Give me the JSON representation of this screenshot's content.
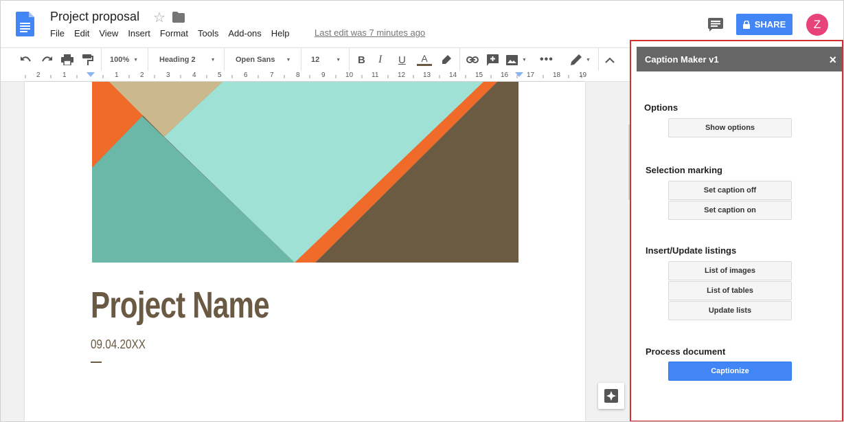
{
  "header": {
    "doc_title": "Project proposal",
    "menu": [
      "File",
      "Edit",
      "View",
      "Insert",
      "Format",
      "Tools",
      "Add-ons",
      "Help"
    ],
    "last_edit": "Last edit was 7 minutes ago",
    "share_label": "SHARE",
    "avatar_letter": "Z"
  },
  "toolbar": {
    "zoom": "100%",
    "style": "Heading 2",
    "font": "Open Sans",
    "font_size": "12"
  },
  "ruler": {
    "numbers": [
      "2",
      "1",
      "1",
      "2",
      "3",
      "4",
      "5",
      "6",
      "7",
      "8",
      "9",
      "10",
      "11",
      "12",
      "13",
      "14",
      "15",
      "16",
      "17",
      "18",
      "19"
    ]
  },
  "document": {
    "project_name": "Project Name",
    "date": "09.04.20XX"
  },
  "sidebar": {
    "title": "Caption Maker v1",
    "close_symbol": "×",
    "sections": {
      "options": {
        "title": "Options",
        "show_options": "Show options"
      },
      "selection": {
        "title": "Selection marking",
        "caption_off": "Set caption off",
        "caption_on": "Set caption on"
      },
      "listings": {
        "title": "Insert/Update listings",
        "list_images": "List of images",
        "list_tables": "List of tables",
        "update_lists": "Update lists"
      },
      "process": {
        "title": "Process document",
        "captionize": "Captionize"
      }
    }
  },
  "colors": {
    "accent_blue": "#4285f4",
    "avatar_pink": "#e8427a",
    "highlight_border": "#d32f2f",
    "heading_brown": "#6a5a44"
  }
}
